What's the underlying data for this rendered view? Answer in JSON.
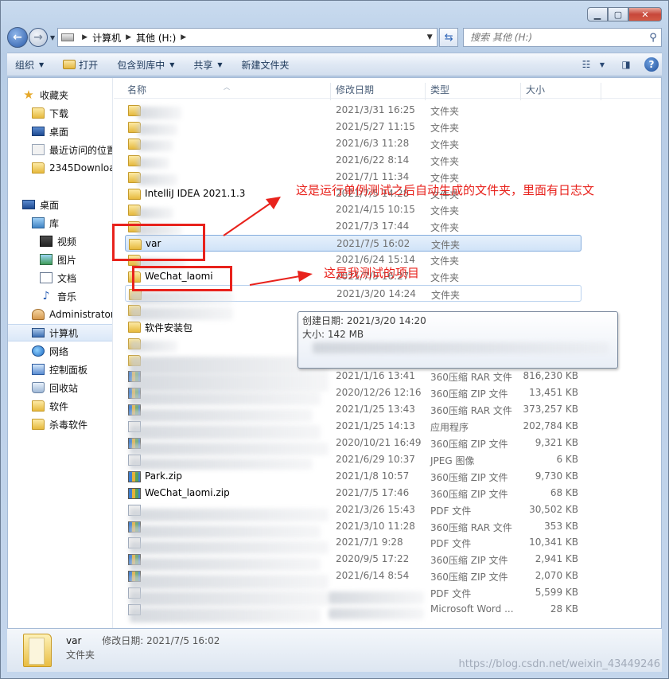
{
  "address": {
    "crumbs": [
      "计算机",
      "其他 (H:)"
    ]
  },
  "search": {
    "placeholder": "搜索 其他 (H:)"
  },
  "toolbar": {
    "organize": "组织",
    "open": "打开",
    "include_library": "包含到库中",
    "share": "共享",
    "new_folder": "新建文件夹"
  },
  "sidebar": {
    "favorites": "收藏夹",
    "downloads": "下载",
    "desktop": "桌面",
    "recent": "最近访问的位置",
    "dl2345": "2345Downloads",
    "desktop2": "桌面",
    "libraries": "库",
    "videos": "视频",
    "pictures": "图片",
    "documents": "文档",
    "music": "音乐",
    "administrator": "Administrator",
    "computer": "计算机",
    "network": "网络",
    "control_panel": "控制面板",
    "recycle_bin": "回收站",
    "software": "软件",
    "antivirus": "杀毒软件"
  },
  "columns": {
    "name": "名称",
    "date": "修改日期",
    "type": "类型",
    "size": "大小"
  },
  "rows": [
    {
      "name": "",
      "date": "2021/3/31 16:25",
      "type": "文件夹",
      "size": ""
    },
    {
      "name": "",
      "date": "2021/5/27 11:15",
      "type": "文件夹",
      "size": ""
    },
    {
      "name": "",
      "date": "2021/6/3 11:28",
      "type": "文件夹",
      "size": ""
    },
    {
      "name": "",
      "date": "2021/6/22 8:14",
      "type": "文件夹",
      "size": ""
    },
    {
      "name": "",
      "date": "2021/7/1 11:34",
      "type": "文件夹",
      "size": ""
    },
    {
      "name": "IntelliJ IDEA 2021.1.3",
      "date": "2021/7/5 14:28",
      "type": "文件夹",
      "size": ""
    },
    {
      "name": "",
      "date": "2021/4/15 10:15",
      "type": "文件夹",
      "size": ""
    },
    {
      "name": "",
      "date": "2021/7/3 17:44",
      "type": "文件夹",
      "size": ""
    },
    {
      "name": "var",
      "date": "2021/7/5 16:02",
      "type": "文件夹",
      "size": ""
    },
    {
      "name": "",
      "date": "2021/6/24 15:14",
      "type": "文件夹",
      "size": ""
    },
    {
      "name": "WeChat_laomi",
      "date": "2021/7/5 16:27",
      "type": "文件夹",
      "size": ""
    },
    {
      "name": "",
      "date": "2021/3/20 14:24",
      "type": "文件夹",
      "size": ""
    },
    {
      "name": "",
      "date": "",
      "type": "",
      "size": ""
    },
    {
      "name": "软件安装包",
      "date": "",
      "type": "",
      "size": ""
    },
    {
      "name": "",
      "date": "",
      "type": "",
      "size": ""
    },
    {
      "name": "",
      "date": "",
      "type": "",
      "size": ""
    },
    {
      "name": "",
      "date": "2021/1/16 13:41",
      "type": "360压缩 RAR 文件",
      "size": "816,230 KB"
    },
    {
      "name": "",
      "date": "2020/12/26 12:16",
      "type": "360压缩 ZIP 文件",
      "size": "13,451 KB"
    },
    {
      "name": "",
      "date": "2021/1/25 13:43",
      "type": "360压缩 RAR 文件",
      "size": "373,257 KB"
    },
    {
      "name": "",
      "date": "2021/1/25 14:13",
      "type": "应用程序",
      "size": "202,784 KB"
    },
    {
      "name": "",
      "date": "2020/10/21 16:49",
      "type": "360压缩 ZIP 文件",
      "size": "9,321 KB"
    },
    {
      "name": "",
      "date": "2021/6/29 10:37",
      "type": "JPEG 图像",
      "size": "6 KB"
    },
    {
      "name": "Park.zip",
      "date": "2021/1/8 10:57",
      "type": "360压缩 ZIP 文件",
      "size": "9,730 KB"
    },
    {
      "name": "WeChat_laomi.zip",
      "date": "2021/7/5 17:46",
      "type": "360压缩 ZIP 文件",
      "size": "68 KB"
    },
    {
      "name": "",
      "date": "2021/3/26 15:43",
      "type": "PDF 文件",
      "size": "30,502 KB"
    },
    {
      "name": "",
      "date": "2021/3/10 11:28",
      "type": "360压缩 RAR 文件",
      "size": "353 KB"
    },
    {
      "name": "",
      "date": "2021/7/1 9:28",
      "type": "PDF 文件",
      "size": "10,341 KB"
    },
    {
      "name": "",
      "date": "2020/9/5 17:22",
      "type": "360压缩 ZIP 文件",
      "size": "2,941 KB"
    },
    {
      "name": "",
      "date": "2021/6/14 8:54",
      "type": "360压缩 ZIP 文件",
      "size": "2,070 KB"
    },
    {
      "name": "",
      "date": "",
      "type": "PDF 文件",
      "size": "5,599 KB"
    },
    {
      "name": "",
      "date": "",
      "type": "Microsoft Word ...",
      "size": "28 KB"
    }
  ],
  "tooltip": {
    "created": "创建日期: 2021/3/20 14:20",
    "size": "大小: 142 MB"
  },
  "annotations": {
    "var_note": "这是运行单例测试之后自动生成的文件夹，里面有日志文",
    "wechat_note": "这是我测试的项目"
  },
  "details": {
    "name": "var",
    "modified_label": "修改日期: 2021/7/5 16:02",
    "type": "文件夹"
  },
  "watermark": "https://blog.csdn.net/weixin_43449246",
  "colors": {
    "annotation_red": "#e8221c",
    "selection_border": "#84acdd"
  }
}
